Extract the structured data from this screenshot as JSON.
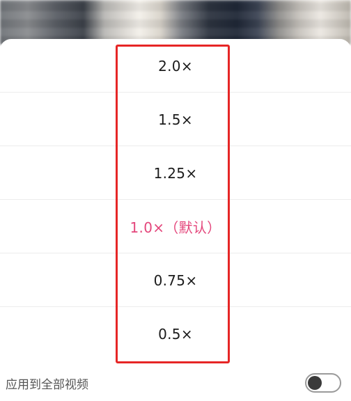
{
  "speed_menu": {
    "options": [
      {
        "label": "2.0×",
        "selected": false
      },
      {
        "label": "1.5×",
        "selected": false
      },
      {
        "label": "1.25×",
        "selected": false
      },
      {
        "label": "1.0×（默认）",
        "selected": true
      },
      {
        "label": "0.75×",
        "selected": false
      },
      {
        "label": "0.5×",
        "selected": false
      }
    ],
    "selected_color": "#e4477c",
    "highlight_color": "#e62626"
  },
  "footer": {
    "apply_all_label": "应用到全部视频",
    "toggle_on": false
  }
}
